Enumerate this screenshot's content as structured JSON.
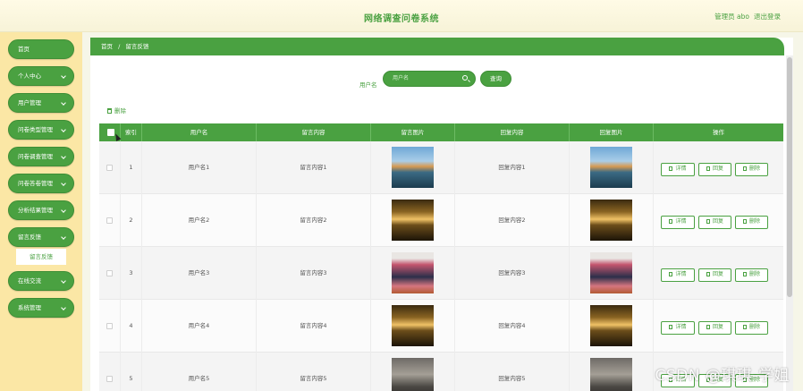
{
  "header": {
    "title": "网络调查问卷系统",
    "admin": "管理员 abo",
    "logout": "退出登录"
  },
  "sidebar": {
    "items": [
      {
        "label": "首页",
        "chevron": false
      },
      {
        "label": "个人中心",
        "chevron": true
      },
      {
        "label": "用户管理",
        "chevron": true
      },
      {
        "label": "问卷类型管理",
        "chevron": true
      },
      {
        "label": "问卷调查管理",
        "chevron": true
      },
      {
        "label": "问卷答卷管理",
        "chevron": true
      },
      {
        "label": "分析结果管理",
        "chevron": true
      },
      {
        "label": "留言反馈",
        "chevron": true,
        "expanded": true
      },
      {
        "label": "在线交流",
        "chevron": true
      },
      {
        "label": "系统管理",
        "chevron": true
      }
    ],
    "subitem": "留言反馈"
  },
  "breadcrumb": {
    "home": "首页",
    "sep": "/",
    "current": "留言反馈"
  },
  "search": {
    "label": "用户名",
    "placeholder": "用户名",
    "button": "查询"
  },
  "toolbar": {
    "delete_label": "删除"
  },
  "table": {
    "columns": [
      "索引",
      "用户名",
      "留言内容",
      "留言图片",
      "回复内容",
      "回复图片",
      "操作"
    ],
    "rows": [
      {
        "index": "1",
        "user": "用户名1",
        "message": "留言内容1",
        "reply": "回复内容1",
        "image": "lake"
      },
      {
        "index": "2",
        "user": "用户名2",
        "message": "留言内容2",
        "reply": "回复内容2",
        "image": "sunset"
      },
      {
        "index": "3",
        "user": "用户名3",
        "message": "留言内容3",
        "reply": "回复内容3",
        "image": "portrait"
      },
      {
        "index": "4",
        "user": "用户名4",
        "message": "留言内容4",
        "reply": "回复内容4",
        "image": "sunset"
      },
      {
        "index": "5",
        "user": "用户名5",
        "message": "留言内容5",
        "reply": "回复内容5",
        "image": "tree"
      }
    ],
    "actions": [
      "详情",
      "回复",
      "删除"
    ]
  },
  "watermark": "CSDN @琪琪-学姐",
  "colors": {
    "accent": "#4aa141",
    "sidebar_bg": "#fbe7a5",
    "header_bg": "#fffbe6"
  }
}
